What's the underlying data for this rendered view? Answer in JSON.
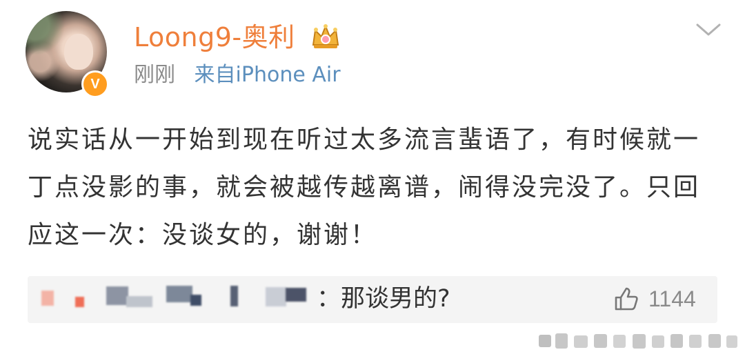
{
  "post": {
    "author": {
      "name": "Loong9-奥利",
      "verified_badge": "V"
    },
    "meta": {
      "time": "刚刚",
      "source": "来自iPhone Air"
    },
    "content": "说实话从一开始到现在听过太多流言蜚语了，有时候就一丁点没影的事，就会被越传越离谱，闹得没完没了。只回应这一次：没谈女的，谢谢！",
    "comment": {
      "text": "：那谈男的?",
      "likes": "1144"
    }
  },
  "icons": {
    "crown": "crown-icon",
    "menu": "chevron-down-icon",
    "like": "thumbs-up-icon"
  },
  "colors": {
    "username": "#ef7f3b",
    "source": "#5c8fbd",
    "verified_badge": "#ff9d1f"
  }
}
